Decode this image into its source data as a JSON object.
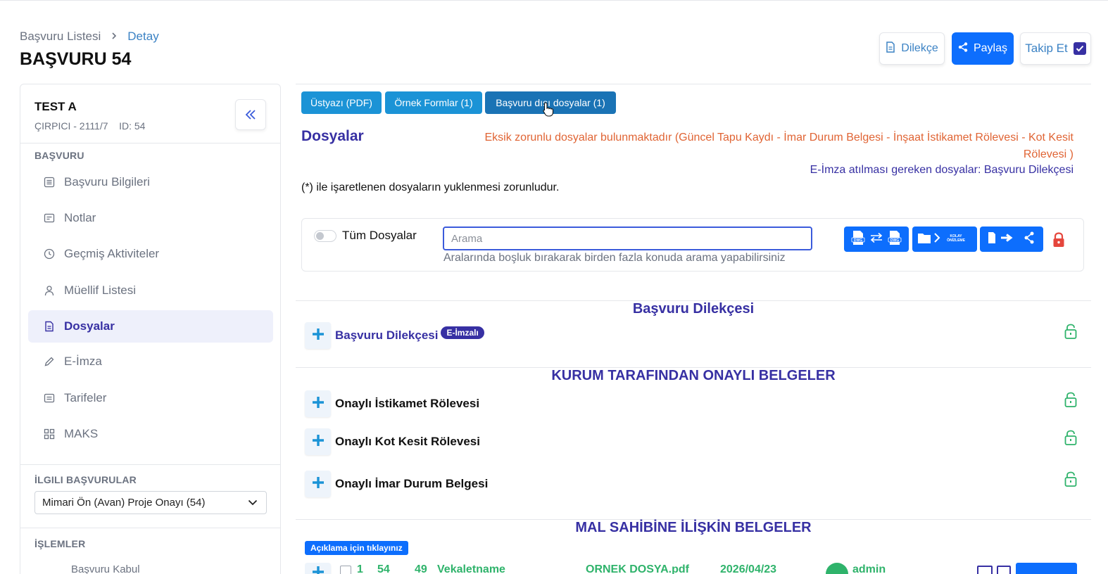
{
  "breadcrumb": {
    "root": "Başvuru Listesi",
    "current": "Detay"
  },
  "page_title": "BAŞVURU 54",
  "header_buttons": {
    "dilekce": "Dilekçe",
    "paylas": "Paylaş",
    "takip": "Takip Et"
  },
  "sidebar": {
    "title": "TEST A",
    "subtitle": "ÇIRPICI - 2111/7    ID: 54",
    "section_basvuru": "BAŞVURU",
    "items": [
      {
        "label": "Başvuru Bilgileri",
        "icon": "list-icon"
      },
      {
        "label": "Notlar",
        "icon": "note-icon"
      },
      {
        "label": "Geçmiş Aktiviteler",
        "icon": "clock-icon"
      },
      {
        "label": "Müellif Listesi",
        "icon": "user-icon"
      },
      {
        "label": "Dosyalar",
        "icon": "file-icon",
        "active": true
      },
      {
        "label": "E-İmza",
        "icon": "pen-icon"
      },
      {
        "label": "Tarifeler",
        "icon": "tariff-icon"
      },
      {
        "label": "MAKS",
        "icon": "grid-icon"
      }
    ],
    "section_related": "İLGILI BAŞVURULAR",
    "related_select": "Mimari Ön (Avan) Proje Onayı (54)",
    "section_actions": "İŞLEMLER",
    "actions_first": "Başvuru Kabul"
  },
  "tabs": [
    "Üstyazı (PDF)",
    "Örnek Formlar (1)",
    "Başvuru dışı dosyalar (1)"
  ],
  "files": {
    "title": "Dosyalar",
    "warning": "Eksik zorunlu dosyalar bulunmaktadır (Güncel Tapu Kaydı - İmar Durum Belgesi - İnşaat İstikamet Rölevesi - Kot Kesit Rölevesi )",
    "esign_prefix": "E-İmza atılması gereken dosyalar: ",
    "esign_files": "Başvuru Dilekçesi",
    "required_note": "(*) ile işaretlenen dosyaların yuklenmesi zorunludur.",
    "toggle_label": "Tüm Dosyalar",
    "search_placeholder": "Arama",
    "search_hint": "Aralarında boşluk bırakarak birden fazla konuda arama yapabilirsiniz"
  },
  "sections": [
    {
      "title": "Başvuru Dilekçesi",
      "rows": [
        {
          "name": "Başvuru Dilekçesi",
          "badge": "E-İmzalı"
        }
      ]
    },
    {
      "title": "KURUM TARAFINDAN ONAYLI BELGELER",
      "rows": [
        {
          "name": "Onaylı İstikamet Rölevesi"
        },
        {
          "name": "Onaylı Kot Kesit Rölevesi"
        },
        {
          "name": "Onaylı İmar Durum Belgesi"
        }
      ]
    },
    {
      "title": "MAL SAHİBİNE İLİŞKİN BELGELER",
      "desc_badge": "Açıklama için tıklayınız",
      "partial_row": {
        "index": "1",
        "app": "54",
        "no": "49",
        "name": "Vekaletname",
        "file": "ORNEK DOSYA.pdf",
        "date": "2026/04/23",
        "user": "admin"
      }
    }
  ],
  "colors": {
    "accent": "#3730a3",
    "primary": "#0d6efd",
    "tab": "#1b93d6",
    "warning": "#e06434",
    "lock_green": "#2fb36b",
    "lock_red": "#e5463c"
  }
}
